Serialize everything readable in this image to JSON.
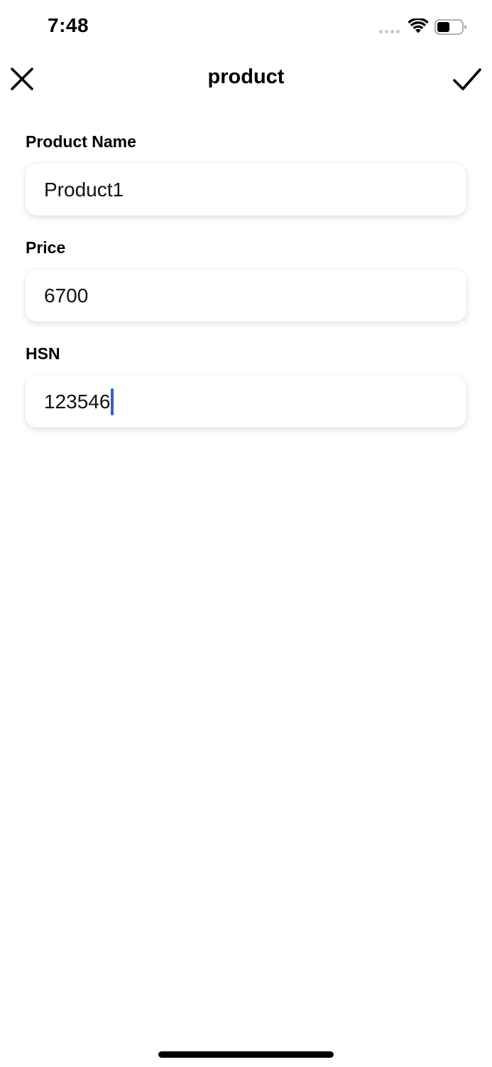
{
  "status_bar": {
    "time": "7:48",
    "icons": [
      "signal-dots-icon",
      "wifi-icon",
      "battery-icon"
    ]
  },
  "nav": {
    "title": "product",
    "close_icon": "close-icon",
    "confirm_icon": "checkmark-icon"
  },
  "form": {
    "fields": [
      {
        "label": "Product Name",
        "value": "Product1"
      },
      {
        "label": "Price",
        "value": "6700"
      },
      {
        "label": "HSN",
        "value": "123546"
      }
    ]
  },
  "colors": {
    "cursor": "#3b5bdb",
    "text": "#000000",
    "background": "#ffffff"
  }
}
